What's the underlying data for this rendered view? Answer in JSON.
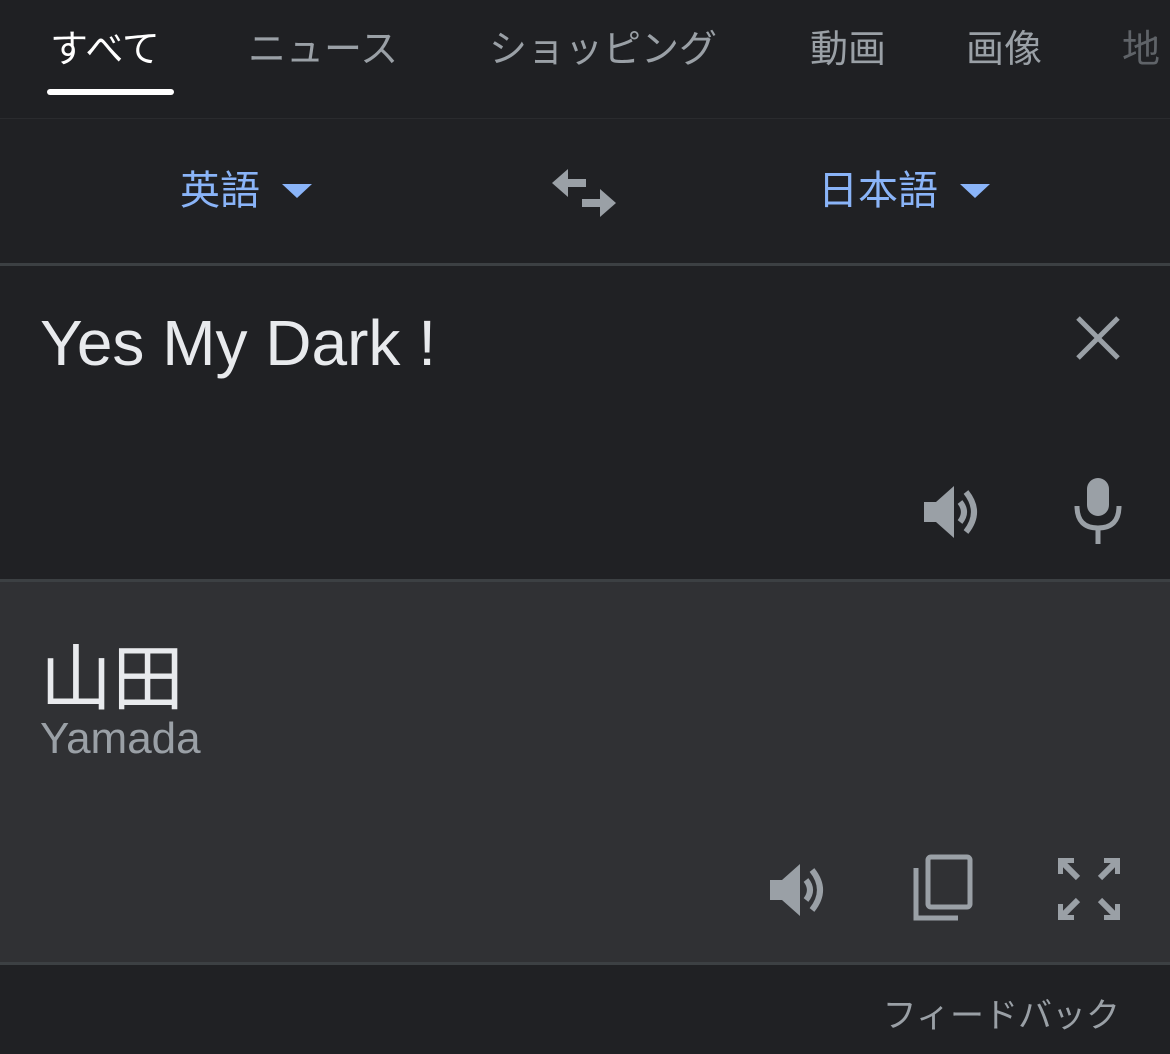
{
  "tabs": [
    {
      "label": "すべて",
      "active": true
    },
    {
      "label": "ニュース"
    },
    {
      "label": "ショッピング"
    },
    {
      "label": "動画"
    },
    {
      "label": "画像"
    },
    {
      "label": "地"
    }
  ],
  "translator": {
    "source_language": "英語",
    "target_language": "日本語",
    "source_text": "Yes My Dark !",
    "translated_text": "山田",
    "romanization": "Yamada"
  },
  "footer": {
    "feedback_label": "フィードバック"
  },
  "icons": {
    "swap": "swap-horiz-icon",
    "clear": "close-icon",
    "listen": "volume-icon",
    "microphone": "mic-icon",
    "copy": "copy-icon",
    "fullscreen": "fullscreen-icon"
  },
  "colors": {
    "background": "#202124",
    "panel": "#303134",
    "accent": "#8ab4f8",
    "text": "#e8eaed",
    "muted": "#9aa0a6"
  }
}
